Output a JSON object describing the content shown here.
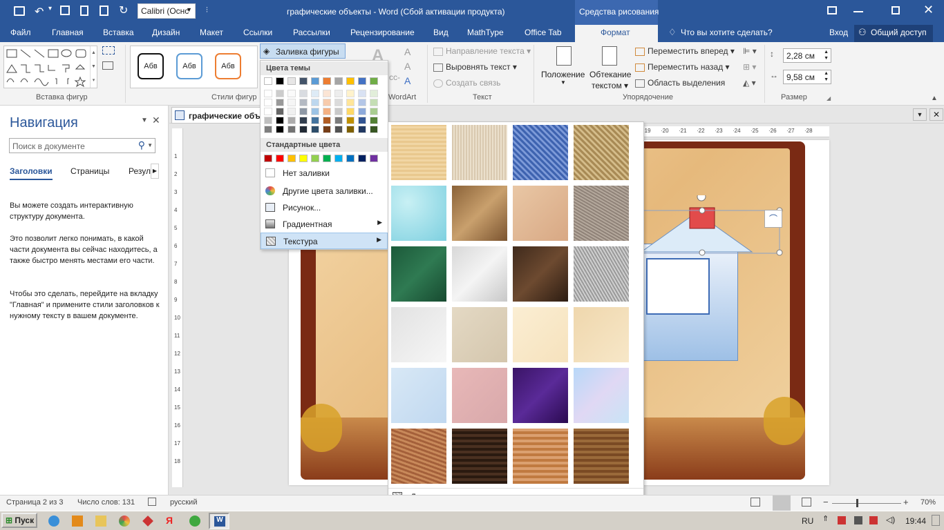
{
  "window": {
    "title": "графические объекты - Word (Сбой активации продукта)",
    "context_tab": "Средства рисования",
    "font_name": "Calibri (Оснс"
  },
  "tabs": {
    "file": "Файл",
    "home": "Главная",
    "insert": "Вставка",
    "design": "Дизайн",
    "layout": "Макет",
    "references": "Ссылки",
    "mailings": "Рассылки",
    "review": "Рецензирование",
    "view": "Вид",
    "mathtype": "MathType",
    "officetab": "Office Tab",
    "format": "Формат",
    "tellme": "Что вы хотите сделать?",
    "signin": "Вход",
    "share": "Общий доступ"
  },
  "ribbon": {
    "insert_shapes_label": "Вставка фигур",
    "shape_styles_label": "Стили фигур",
    "style_sample": "Абв",
    "fill_button": "Заливка фигуры",
    "wordart_label": "WordArt",
    "text_direction": "Направление текста",
    "align_text": "Выровнять текст",
    "create_link": "Создать связь",
    "text_label": "Текст",
    "position": "Положение",
    "wrap_text_1": "Обтекание",
    "wrap_text_2": "текстом",
    "bring_forward": "Переместить вперед",
    "send_backward": "Переместить назад",
    "selection_pane": "Область выделения",
    "arrange_label": "Упорядочение",
    "height": "2,28 см",
    "width": "9,58 см",
    "size_label": "Размер"
  },
  "nav": {
    "title": "Навигация",
    "search_placeholder": "Поиск в документе",
    "tabs": [
      "Заголовки",
      "Страницы",
      "Резул"
    ],
    "para1": "Вы можете создать интерактивную структуру документа.",
    "para2": "Это позволит легко понимать, в какой части документа вы сейчас находитесь, а также быстро менять местами его части.",
    "para3": "Чтобы это сделать, перейдите на вкладку \"Главная\" и примените стили заголовков к нужному тексту в вашем документе."
  },
  "doc_tab": "графические объ",
  "ruler_h": [
    "19",
    "20",
    "21",
    "22",
    "23",
    "24",
    "25",
    "26",
    "27",
    "28"
  ],
  "ruler_v": [
    "1",
    "2",
    "3",
    "4",
    "5",
    "6",
    "7",
    "8",
    "9",
    "10",
    "11",
    "12",
    "13",
    "14",
    "15",
    "16",
    "17",
    "18"
  ],
  "fill_menu": {
    "theme_colors": "Цвета темы",
    "theme_top": [
      "#ffffff",
      "#000000",
      "#e7e6e6",
      "#44546a",
      "#5b9bd5",
      "#ed7d31",
      "#a5a5a5",
      "#ffc000",
      "#4472c4",
      "#70ad47"
    ],
    "standard_colors": "Стандартные цвета",
    "standard": [
      "#c00000",
      "#ff0000",
      "#ffc000",
      "#ffff00",
      "#92d050",
      "#00b050",
      "#00b0f0",
      "#0070c0",
      "#002060",
      "#7030a0"
    ],
    "no_fill": "Нет заливки",
    "more_colors": "Другие цвета заливки...",
    "picture": "Рисунок...",
    "gradient": "Градиентная",
    "texture": "Текстура"
  },
  "texture_menu": {
    "more": "Другие текстуры..."
  },
  "status": {
    "page": "Страница 2 из 3",
    "words": "Число слов: 131",
    "lang": "русский",
    "zoom": "70%"
  },
  "taskbar": {
    "start": "Пуск",
    "lang": "RU",
    "time": "19:44"
  }
}
